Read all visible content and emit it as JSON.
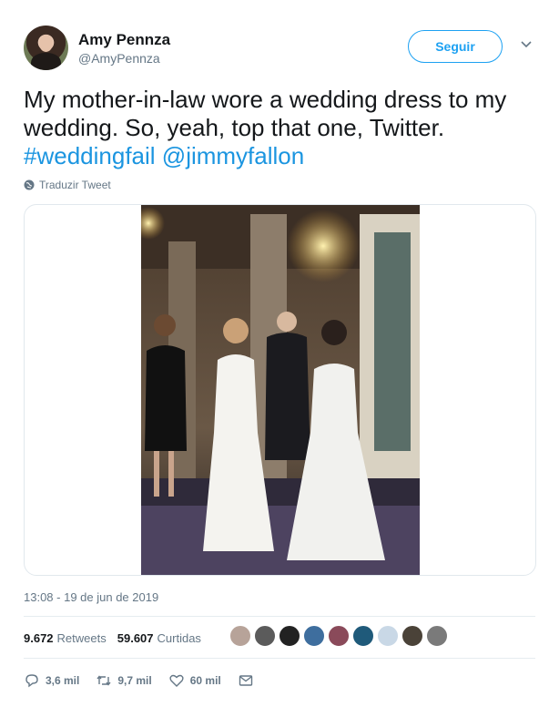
{
  "author": {
    "name": "Amy Pennza",
    "handle": "@AmyPennza"
  },
  "follow_label": "Seguir",
  "tweet": {
    "text_before": "My mother-in-law wore a wedding dress to my wedding. So, yeah, top that one, Twitter.",
    "hashtag": "#weddingfail",
    "mention": "@jimmyfallon"
  },
  "translate_label": "Traduzir Tweet",
  "timestamp": "13:08 - 19 de jun de 2019",
  "stats": {
    "retweets_count": "9.672",
    "retweets_label": "Retweets",
    "likes_count": "59.607",
    "likes_label": "Curtidas"
  },
  "actions": {
    "replies": "3,6 mil",
    "retweets": "9,7 mil",
    "likes": "60 mil"
  },
  "colors": {
    "accent": "#1da1f2",
    "link": "#1b95e0",
    "muted": "#657786"
  },
  "icons": [
    "chevron-down-icon",
    "globe-icon",
    "reply-icon",
    "retweet-icon",
    "heart-icon",
    "message-icon"
  ]
}
